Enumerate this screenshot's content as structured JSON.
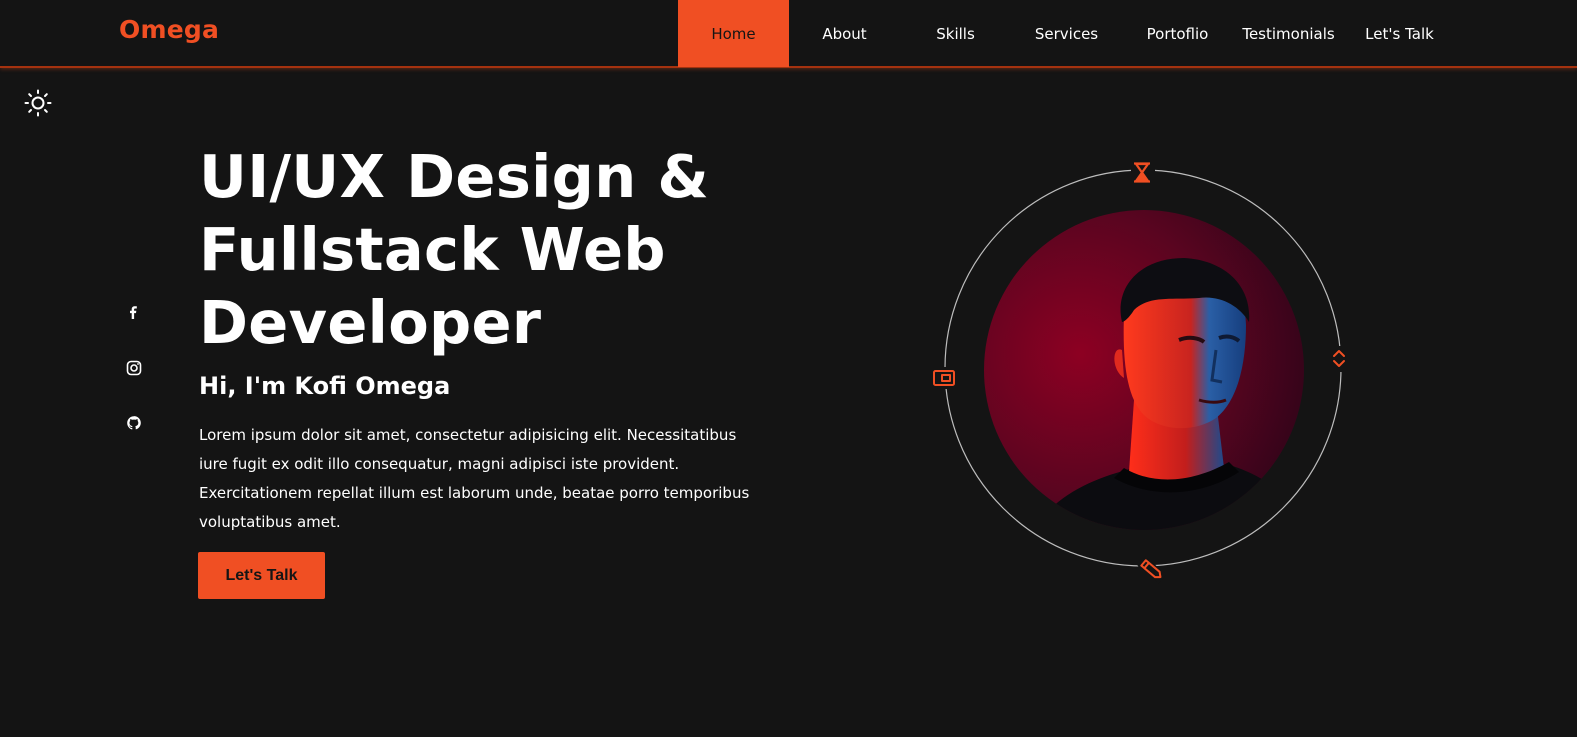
{
  "brand": {
    "logo": "Omega",
    "accent_color": "#f04f23",
    "background_color": "#141414"
  },
  "nav": {
    "items": [
      {
        "label": "Home",
        "active": true
      },
      {
        "label": "About"
      },
      {
        "label": "Skills"
      },
      {
        "label": "Services"
      },
      {
        "label": "Portoflio"
      },
      {
        "label": "Testimonials"
      },
      {
        "label": "Let's Talk"
      }
    ]
  },
  "theme_toggle": {
    "icon": "sun-icon"
  },
  "social": [
    {
      "icon": "facebook-icon"
    },
    {
      "icon": "instagram-icon"
    },
    {
      "icon": "github-icon"
    }
  ],
  "hero": {
    "title_lines": [
      "UI/UX Design &",
      "Fullstack Web",
      "Developer"
    ],
    "greeting": "Hi, I'm Kofi Omega",
    "description": "Lorem ipsum dolor sit amet, consectetur adipisicing elit. Necessitatibus iure fugit ex odit illo consequatur, magni adipisci iste provident. Exercitationem repellat illum est laborum unde, beatae porro temporibus voluptatibus amet.",
    "cta_label": "Let's Talk"
  },
  "profile": {
    "orbit_icons": [
      "hourglass-icon",
      "code-icon",
      "wallet-icon",
      "pen-icon"
    ]
  }
}
